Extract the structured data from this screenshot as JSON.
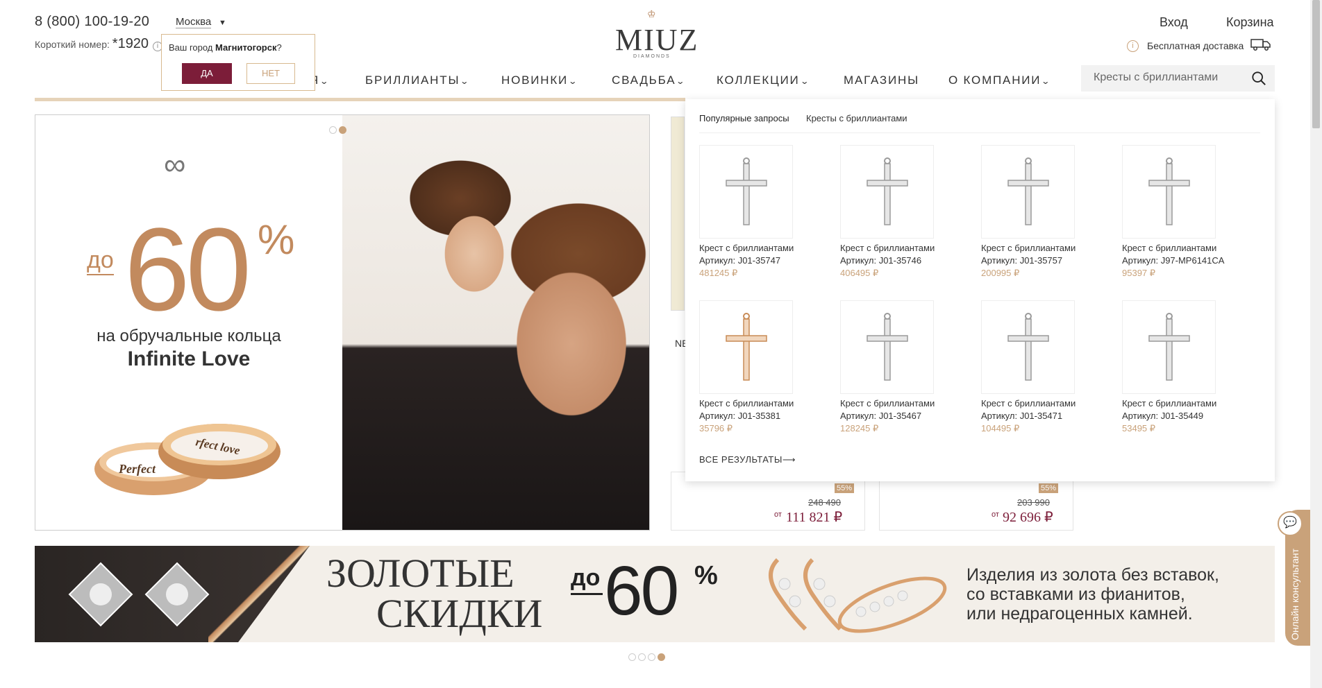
{
  "header": {
    "phone": "8 (800) 100-19-20",
    "short_label": "Короткий номер:",
    "short_number": "*1920",
    "city": "Москва",
    "city_prompt": "Ваш город",
    "city_guess": "Магнитогорск",
    "city_yes": "ДА",
    "city_no": "НЕТ",
    "logo": "MIUZ",
    "logo_sub": "DIAMONDS",
    "login": "Вход",
    "cart": "Корзина",
    "shipping": "Бесплатная доставка"
  },
  "nav": {
    "items": [
      {
        "label": "Я"
      },
      {
        "label": "БРИЛЛИАНТЫ"
      },
      {
        "label": "НОВИНКИ"
      },
      {
        "label": "СВАДЬБА"
      },
      {
        "label": "КОЛЛЕКЦИИ"
      },
      {
        "label": "МАГАЗИНЫ"
      },
      {
        "label": "О КОМПАНИИ"
      }
    ],
    "search_value": "Кресты с бриллиантами"
  },
  "banner": {
    "do": "до",
    "percent": "60",
    "percent_sign": "%",
    "line1": "на обручальные кольца",
    "line2": "Infinite Love",
    "ring_text1": "Perfect",
    "ring_text2": "rfect love"
  },
  "peek": {
    "text": "NE",
    "cards": [
      {
        "badge": "55%",
        "old": "248 490",
        "from": "от",
        "new": "111 821 ₽"
      },
      {
        "badge": "55%",
        "old": "203 990",
        "from": "от",
        "new": "92 696 ₽"
      }
    ]
  },
  "search_dropdown": {
    "popular_label": "Популярные запросы",
    "popular_link": "Кресты с бриллиантами",
    "all_results": "ВСЕ РЕЗУЛЬТАТЫ⟶",
    "items": [
      {
        "name": "Крест с бриллиантами",
        "article": "Артикул: J01-35747",
        "price": "481245 ₽",
        "metal": "white"
      },
      {
        "name": "Крест с бриллиантами",
        "article": "Артикул: J01-35746",
        "price": "406495 ₽",
        "metal": "white"
      },
      {
        "name": "Крест с бриллиантами",
        "article": "Артикул: J01-35757",
        "price": "200995 ₽",
        "metal": "white"
      },
      {
        "name": "Крест с бриллиантами",
        "article": "Артикул: J97-MP6141CA",
        "price": "95397 ₽",
        "metal": "white"
      },
      {
        "name": "Крест с бриллиантами",
        "article": "Артикул: J01-35381",
        "price": "35796 ₽",
        "metal": "rose"
      },
      {
        "name": "Крест с бриллиантами",
        "article": "Артикул: J01-35467",
        "price": "128245 ₽",
        "metal": "white"
      },
      {
        "name": "Крест с бриллиантами",
        "article": "Артикул: J01-35471",
        "price": "104495 ₽",
        "metal": "white"
      },
      {
        "name": "Крест с бриллиантами",
        "article": "Артикул: J01-35449",
        "price": "53495 ₽",
        "metal": "white"
      }
    ]
  },
  "bottom_banner": {
    "title1": "ЗОЛОТЫЕ",
    "title2": "СКИДКИ",
    "do": "до",
    "percent": "60",
    "percent_sign": "%",
    "text1": "Изделия из золота без вставок,",
    "text2": "со вставками из фианитов,",
    "text3": "или недрагоценных камней."
  },
  "consultant": "Онлайн консультант",
  "colors": {
    "accent": "#c9a27a",
    "brand": "#7c1d39",
    "price": "#c9a27a"
  }
}
